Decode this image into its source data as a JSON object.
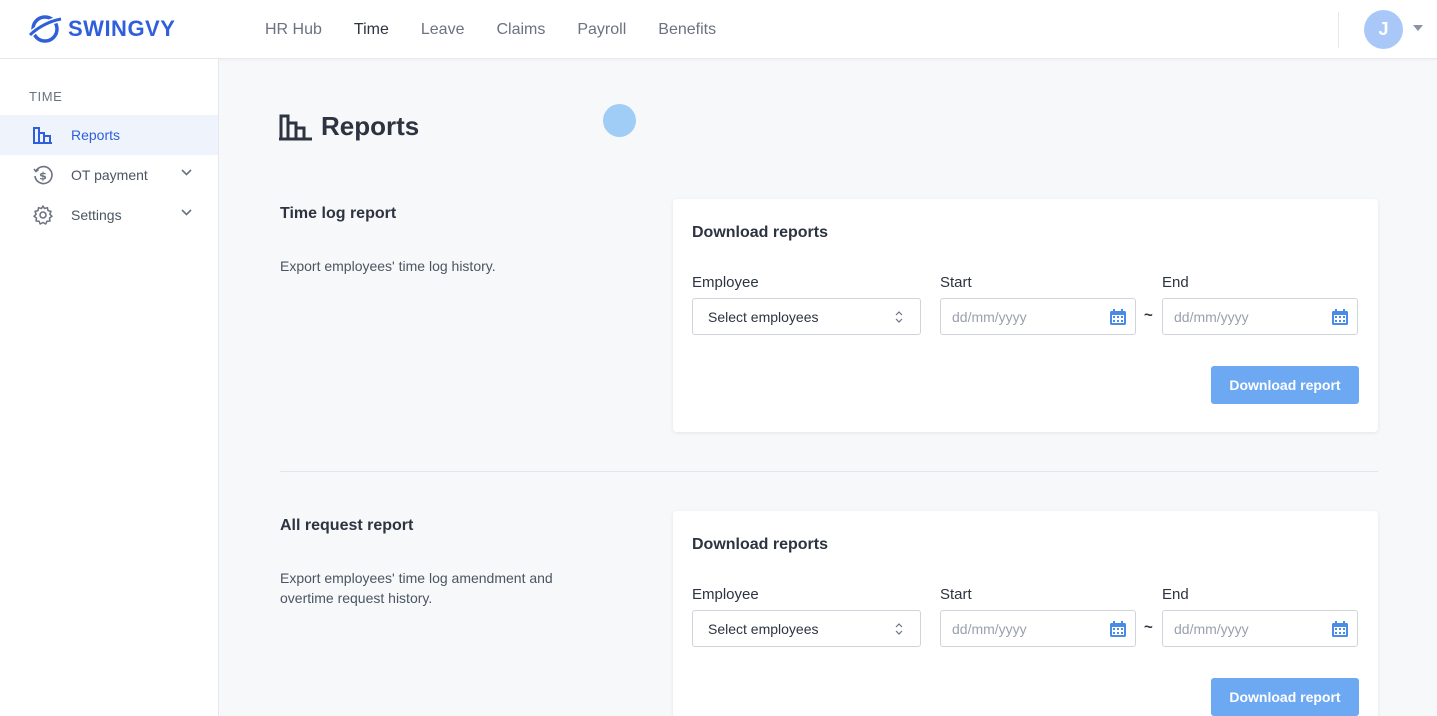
{
  "brand": {
    "name": "SWINGVY",
    "color": "#2f5fdb"
  },
  "nav": {
    "items": [
      {
        "label": "HR Hub",
        "active": false
      },
      {
        "label": "Time",
        "active": true
      },
      {
        "label": "Leave",
        "active": false
      },
      {
        "label": "Claims",
        "active": false
      },
      {
        "label": "Payroll",
        "active": false
      },
      {
        "label": "Benefits",
        "active": false
      }
    ],
    "avatar_initial": "J"
  },
  "sidebar": {
    "section_label": "TIME",
    "items": [
      {
        "label": "Reports",
        "icon": "bar-chart-icon",
        "active": true
      },
      {
        "label": "OT payment",
        "icon": "dollar-clock-icon",
        "expandable": true
      },
      {
        "label": "Settings",
        "icon": "gear-icon",
        "expandable": true
      }
    ]
  },
  "page": {
    "title": "Reports"
  },
  "reports": [
    {
      "title": "Time log report",
      "description": "Export employees' time log history.",
      "card_title": "Download reports",
      "employee_label": "Employee",
      "employee_value": "Select employees",
      "start_label": "Start",
      "start_placeholder": "dd/mm/yyyy",
      "end_label": "End",
      "end_placeholder": "dd/mm/yyyy",
      "separator": "~",
      "button_label": "Download report"
    },
    {
      "title": "All request report",
      "description": "Export employees' time log amendment and overtime request history.",
      "card_title": "Download reports",
      "employee_label": "Employee",
      "employee_value": "Select employees",
      "start_label": "Start",
      "start_placeholder": "dd/mm/yyyy",
      "end_label": "End",
      "end_placeholder": "dd/mm/yyyy",
      "separator": "~",
      "button_label": "Download report"
    }
  ],
  "colors": {
    "accent": "#2f5fdb",
    "button": "#6da8f3",
    "active_bg": "#eef3fc"
  }
}
